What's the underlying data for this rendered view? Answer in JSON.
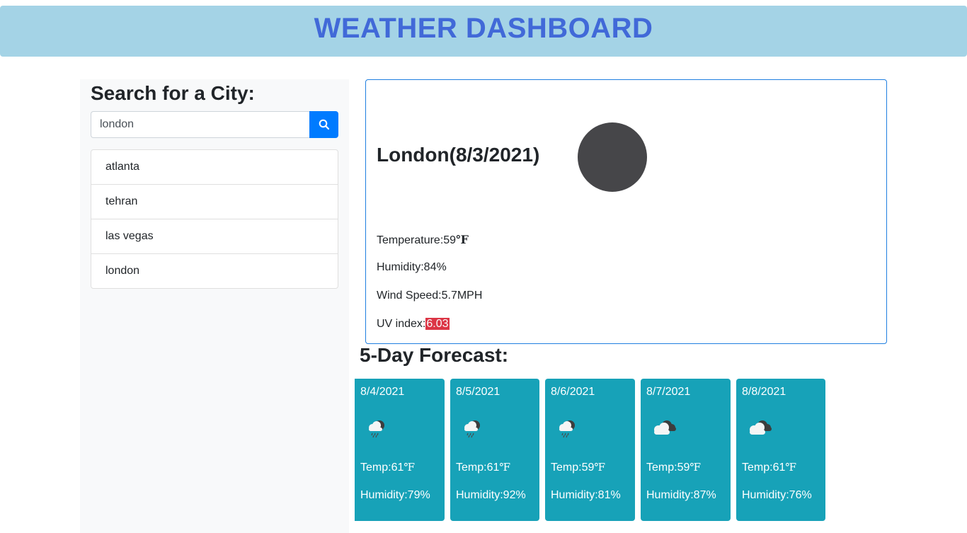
{
  "header": {
    "title": "WEATHER DASHBOARD"
  },
  "search": {
    "heading": "Search for a City:",
    "value": "london",
    "button_icon": "search-icon"
  },
  "history": [
    "atlanta",
    "tehran",
    "las vegas",
    "london"
  ],
  "current": {
    "title": "London(8/3/2021)",
    "temp_label": "Temperature:",
    "temp_value": "59",
    "temp_unit": "℉",
    "humidity": "Humidity:84%",
    "wind": "Wind Speed:5.7MPH",
    "uv_label": "UV index:",
    "uv_value": "6.03",
    "uv_color": "#dc3545",
    "icon": "weather-icon"
  },
  "forecast": {
    "heading": "5-Day Forecast:",
    "card_color": "#17a2b8",
    "days": [
      {
        "date": "8/4/2021",
        "icon": "rain-cloud-icon",
        "temp_label": "Temp:",
        "temp_value": "61",
        "unit": "℉",
        "humidity": "Humidity:79%"
      },
      {
        "date": "8/5/2021",
        "icon": "rain-cloud-icon",
        "temp_label": "Temp:",
        "temp_value": "61",
        "unit": "℉",
        "humidity": "Humidity:92%"
      },
      {
        "date": "8/6/2021",
        "icon": "rain-cloud-icon",
        "temp_label": "Temp:",
        "temp_value": "59",
        "unit": "℉",
        "humidity": "Humidity:81%"
      },
      {
        "date": "8/7/2021",
        "icon": "clouds-icon",
        "temp_label": "Temp:",
        "temp_value": "59",
        "unit": "℉",
        "humidity": "Humidity:87%"
      },
      {
        "date": "8/8/2021",
        "icon": "clouds-icon",
        "temp_label": "Temp:",
        "temp_value": "61",
        "unit": "℉",
        "humidity": "Humidity:76%"
      }
    ]
  }
}
